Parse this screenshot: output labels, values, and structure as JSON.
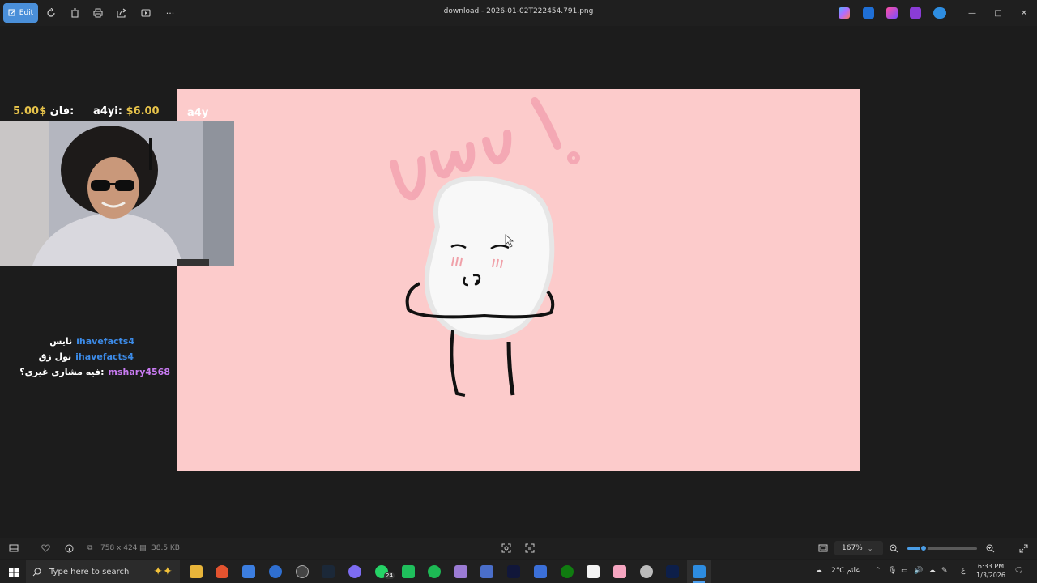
{
  "toolbar": {
    "edit_label": "Edit",
    "more_label": "···"
  },
  "window": {
    "title": "download - 2026-01-02T222454.791.png",
    "minimize": "—",
    "maximize": "□",
    "close": "✕"
  },
  "stream_overlay": {
    "donation_top_label": "a4yi:",
    "donation_top_amount": "$6.00",
    "donation_second_label": "فان:",
    "donation_second_amount": "5.00$",
    "watermark": "a4y"
  },
  "chat": [
    {
      "user": "ihavefacts4",
      "message": "نايس",
      "color": "#3c8be8"
    },
    {
      "user": "ihavefacts4",
      "message": "نول زق",
      "color": "#3c8be8"
    },
    {
      "user": "mshary4568",
      "message": "فيه مشاري غيري؟:",
      "color": "#c97bf2"
    }
  ],
  "image_text": "UwU!",
  "status": {
    "dimensions": "758 x 424",
    "file_size": "38.5 KB",
    "zoom": "167%"
  },
  "taskbar": {
    "search_placeholder": "Type here to search",
    "whatsapp_badge": "24",
    "weather": "2°C",
    "weather_label": "غائم",
    "lang": "ع",
    "time": "6:33 PM",
    "date": "1/3/2026"
  }
}
